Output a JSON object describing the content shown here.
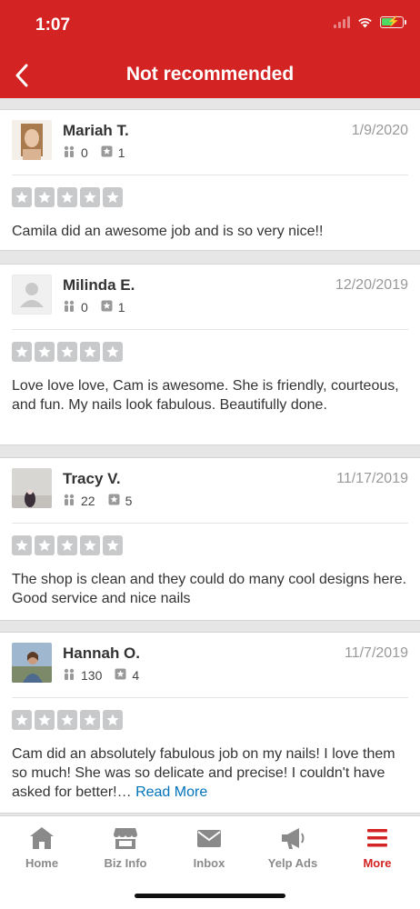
{
  "status_bar": {
    "time": "1:07"
  },
  "nav": {
    "title": "Not recommended"
  },
  "reviews": [
    {
      "name": "Mariah T.",
      "date": "1/9/2020",
      "friends": "0",
      "reviews": "1",
      "rating": 5,
      "text": "Camila did an awesome job and is so very nice!!",
      "read_more": ""
    },
    {
      "name": "Milinda E.",
      "date": "12/20/2019",
      "friends": "0",
      "reviews": "1",
      "rating": 5,
      "text": "Love love love, Cam is awesome. She is friendly, courteous, and fun.  My nails look fabulous. Beautifully done.",
      "read_more": ""
    },
    {
      "name": "Tracy V.",
      "date": "11/17/2019",
      "friends": "22",
      "reviews": "5",
      "rating": 5,
      "text": "The shop is clean and they could do many cool designs here. Good service and nice nails",
      "read_more": ""
    },
    {
      "name": "Hannah O.",
      "date": "11/7/2019",
      "friends": "130",
      "reviews": "4",
      "rating": 5,
      "text": "Cam did an absolutely fabulous job on my nails! I love them so much! She was so delicate and precise! I couldn't have asked for better!…",
      "read_more": "Read More"
    }
  ],
  "tab_bar": {
    "items": [
      {
        "label": "Home",
        "icon": "home-icon"
      },
      {
        "label": "Biz Info",
        "icon": "storefront-icon"
      },
      {
        "label": "Inbox",
        "icon": "envelope-icon"
      },
      {
        "label": "Yelp Ads",
        "icon": "megaphone-icon"
      },
      {
        "label": "More",
        "icon": "menu-icon",
        "active": true
      }
    ]
  },
  "colors": {
    "brand_red": "#d32323",
    "link_blue": "#0073bb",
    "star_gray": "#c8c9ca",
    "tab_gray": "#8a8a8a"
  }
}
